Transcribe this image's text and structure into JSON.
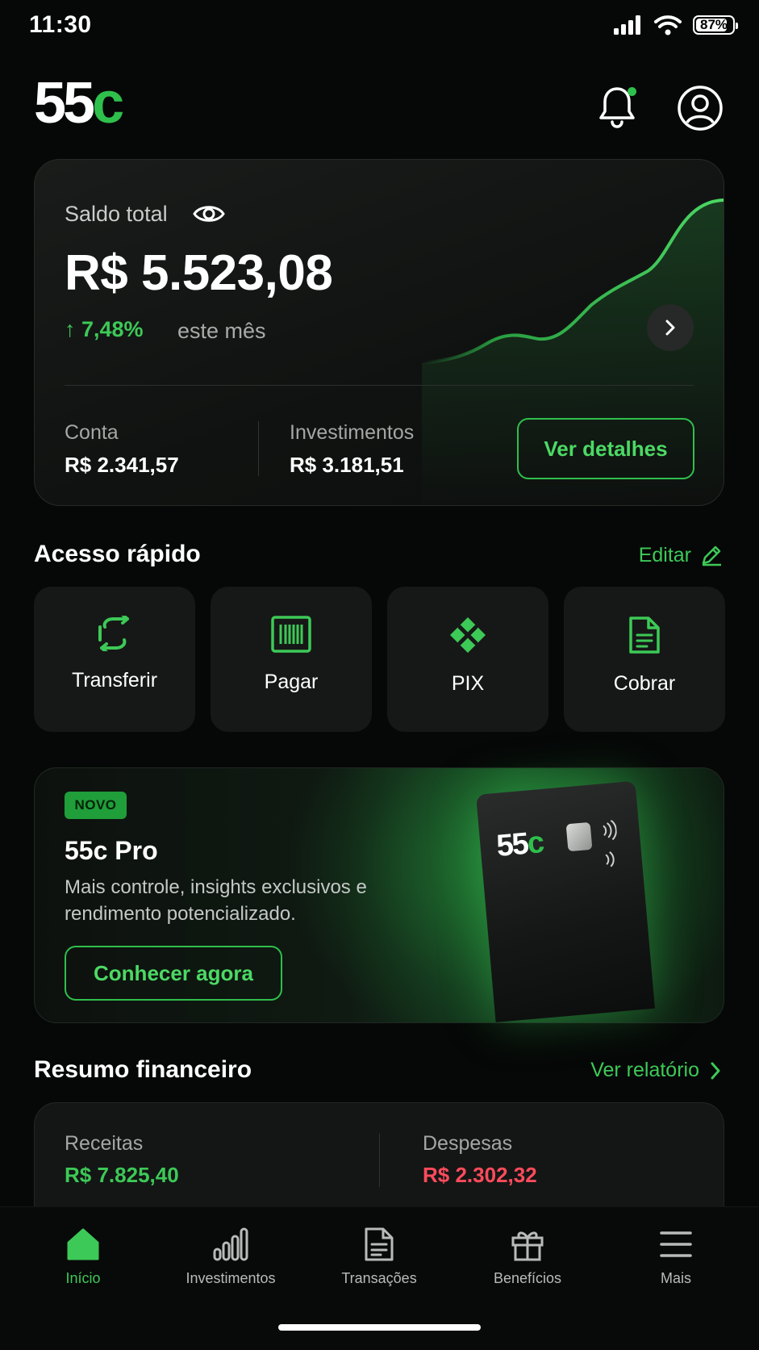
{
  "status_bar": {
    "time": "11:30",
    "battery": "87%"
  },
  "header": {
    "logo_main": "55",
    "logo_accent": "c"
  },
  "balance_card": {
    "label": "Saldo total",
    "amount": "R$ 5.523,08",
    "change": "↑ 7,48%",
    "change_note": "este mês",
    "conta_label": "Conta",
    "conta_value": "R$ 2.341,57",
    "investimentos_label": "Investimentos",
    "investimentos_value": "R$ 3.181,51",
    "details_button": "Ver detalhes"
  },
  "quick_access": {
    "title": "Acesso rápido",
    "edit_label": "Editar",
    "items": [
      {
        "label": "Transferir",
        "icon": "transfer-icon"
      },
      {
        "label": "Pagar",
        "icon": "barcode-icon"
      },
      {
        "label": "PIX",
        "icon": "pix-icon"
      },
      {
        "label": "Cobrar",
        "icon": "document-icon"
      }
    ]
  },
  "promo": {
    "badge": "NOVO",
    "title": "55c Pro",
    "description": "Mais controle, insights exclusivos e rendimento potencializado.",
    "button": "Conhecer agora",
    "card_logo_main": "55",
    "card_logo_accent": "c"
  },
  "summary": {
    "title": "Resumo financeiro",
    "link": "Ver relatório",
    "receitas_label": "Receitas",
    "receitas_value": "R$ 7.825,40",
    "despesas_label": "Despesas",
    "despesas_value": "R$ 2.302,32"
  },
  "bottom_nav": {
    "items": [
      {
        "label": "Início",
        "icon": "home-icon",
        "active": true
      },
      {
        "label": "Investimentos",
        "icon": "bar-chart-icon",
        "active": false
      },
      {
        "label": "Transações",
        "icon": "receipt-icon",
        "active": false
      },
      {
        "label": "Benefícios",
        "icon": "gift-icon",
        "active": false
      },
      {
        "label": "Mais",
        "icon": "menu-icon",
        "active": false
      }
    ]
  },
  "colors": {
    "accent": "#2fbf4c",
    "negative": "#ff4b5c",
    "background": "#060707"
  }
}
